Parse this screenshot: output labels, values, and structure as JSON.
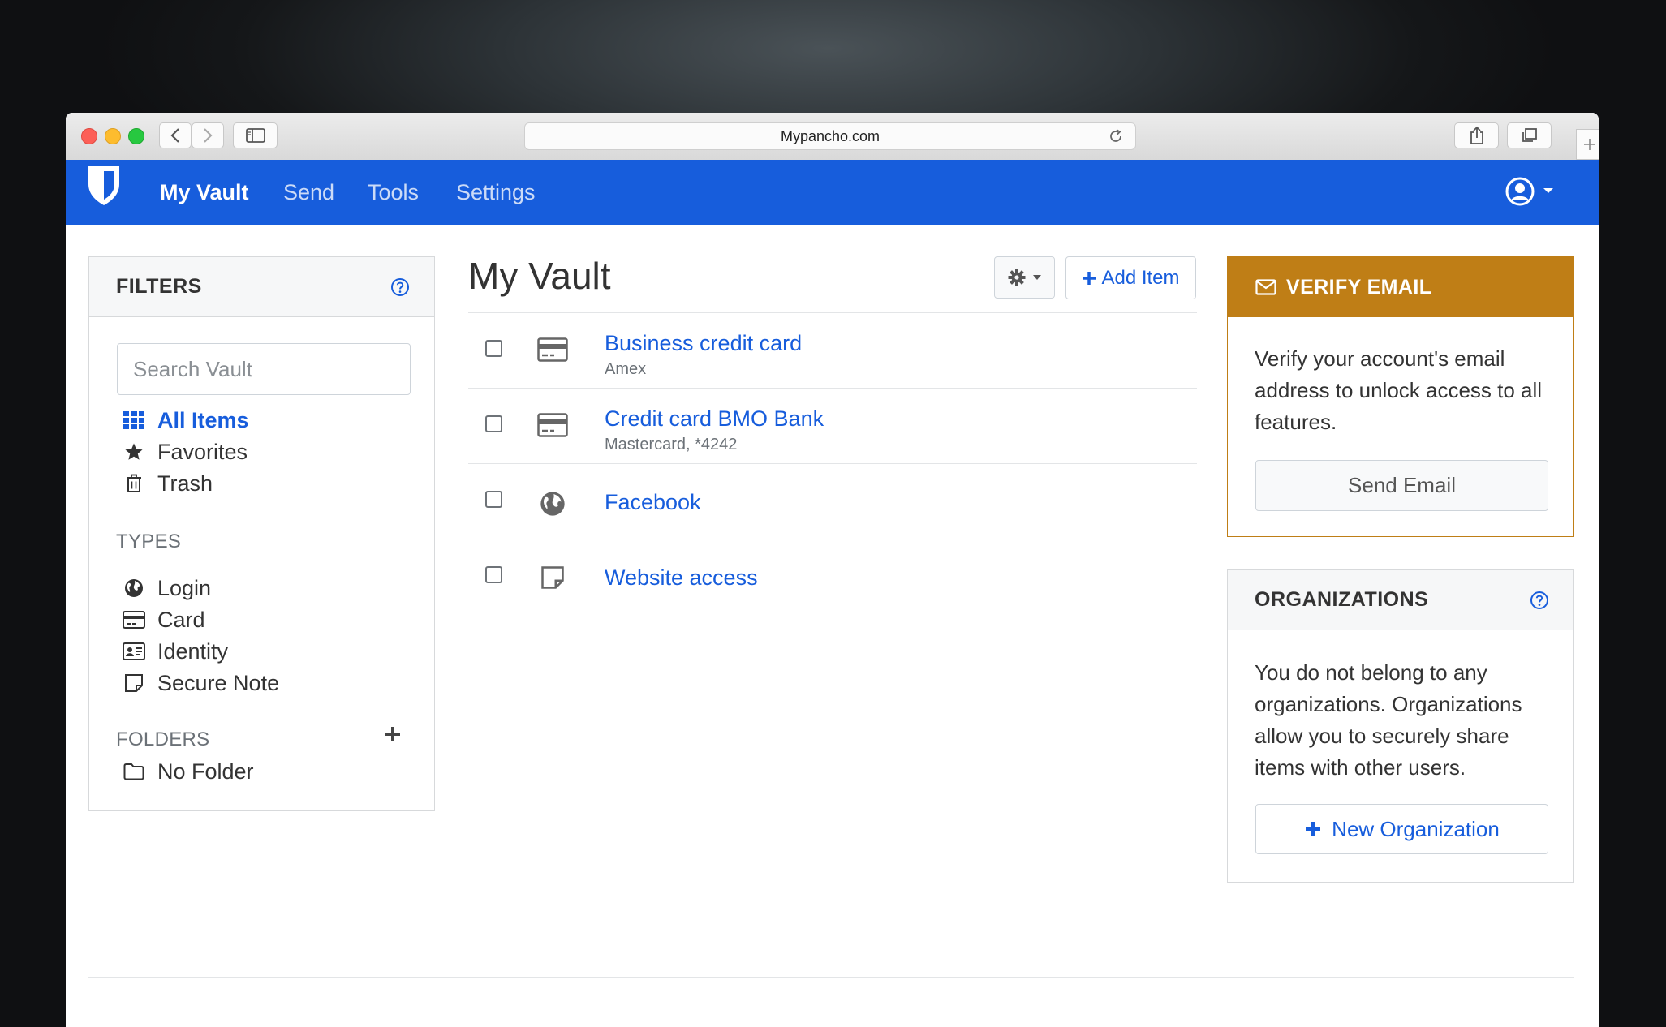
{
  "browser": {
    "url": "Mypancho.com"
  },
  "navbar": {
    "links": [
      "My Vault",
      "Send",
      "Tools",
      "Settings"
    ],
    "active_index": 0
  },
  "filters": {
    "title": "FILTERS",
    "search_placeholder": "Search Vault",
    "all_items": "All Items",
    "favorites": "Favorites",
    "trash": "Trash",
    "types_heading": "TYPES",
    "types": [
      "Login",
      "Card",
      "Identity",
      "Secure Note"
    ],
    "folders_heading": "FOLDERS",
    "folders": [
      "No Folder"
    ]
  },
  "main": {
    "title": "My Vault",
    "add_item_label": "Add Item",
    "items": [
      {
        "name": "Business credit card",
        "sub": "Amex",
        "type_icon": "card-icon"
      },
      {
        "name": "Credit card BMO Bank",
        "sub": "Mastercard, *4242",
        "type_icon": "card-icon"
      },
      {
        "name": "Facebook",
        "sub": "",
        "type_icon": "globe-icon"
      },
      {
        "name": "Website access",
        "sub": "",
        "type_icon": "note-icon"
      }
    ]
  },
  "verify": {
    "title": "VERIFY EMAIL",
    "body": "Verify your account's email address to unlock access to all features.",
    "button": "Send Email"
  },
  "orgs": {
    "title": "ORGANIZATIONS",
    "body": "You do not belong to any organizations. Organizations allow you to securely share items with other users.",
    "button": "New Organization"
  },
  "colors": {
    "brand": "#175ddc",
    "warning": "#bf7e16"
  }
}
